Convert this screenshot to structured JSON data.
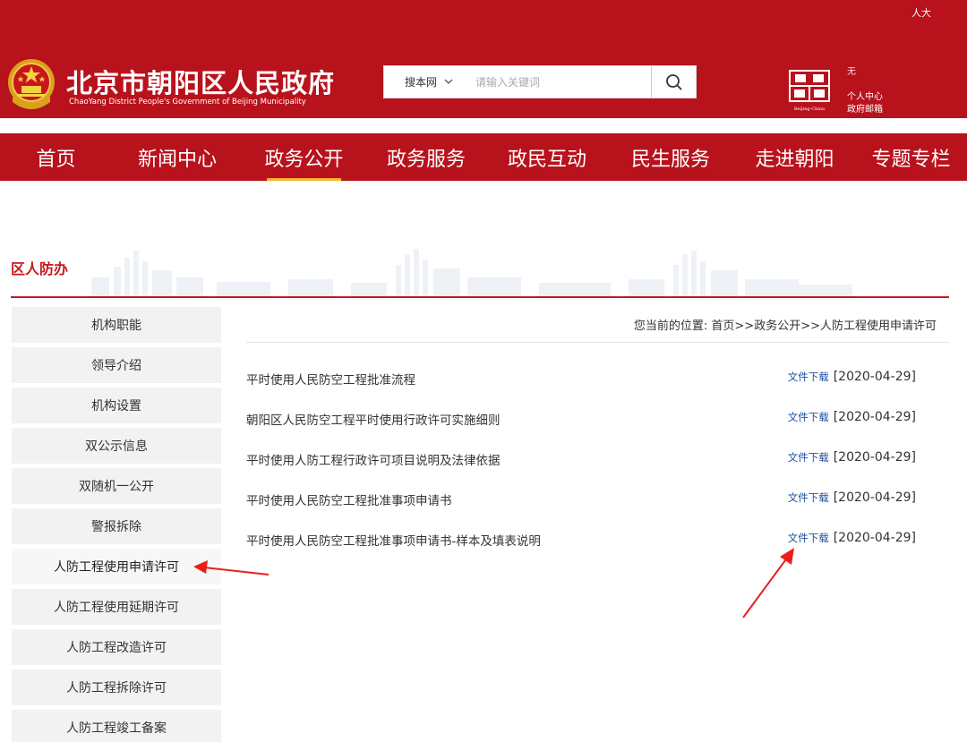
{
  "header": {
    "title": "北京市朝阳区人民政府",
    "subtitle": "ChaoYang District People's Government of Beijing Municipality",
    "top_links": "人大",
    "search": {
      "scope": "搜本网",
      "placeholder": "请输入关键词"
    },
    "logo_text": "Beijing-China",
    "right_links": {
      "item1": "无",
      "personal_center": "个人中心",
      "gov_mail": "政府邮箱"
    }
  },
  "nav": {
    "items": [
      {
        "label": "首页"
      },
      {
        "label": "新闻中心"
      },
      {
        "label": "政务公开"
      },
      {
        "label": "政务服务"
      },
      {
        "label": "政民互动"
      },
      {
        "label": "民生服务"
      },
      {
        "label": "走进朝阳"
      },
      {
        "label": "专题专栏"
      }
    ],
    "active_index": 2
  },
  "section": {
    "title": "区人防办"
  },
  "sidebar": {
    "items": [
      {
        "label": "机构职能"
      },
      {
        "label": "领导介绍"
      },
      {
        "label": "机构设置"
      },
      {
        "label": "双公示信息"
      },
      {
        "label": "双随机一公开"
      },
      {
        "label": "警报拆除"
      },
      {
        "label": "人防工程使用申请许可"
      },
      {
        "label": "人防工程使用延期许可"
      },
      {
        "label": "人防工程改造许可"
      },
      {
        "label": "人防工程拆除许可"
      },
      {
        "label": "人防工程竣工备案"
      }
    ],
    "active_index": 6
  },
  "breadcrumb": "您当前的位置: 首页>>政务公开>>人防工程使用申请许可",
  "documents": [
    {
      "title": "平时使用人民防空工程批准流程",
      "download": "文件下载",
      "date": "[2020-04-29]"
    },
    {
      "title": "朝阳区人民防空工程平时使用行政许可实施细则",
      "download": "文件下载",
      "date": "[2020-04-29]"
    },
    {
      "title": "平时使用人防工程行政许可项目说明及法律依据",
      "download": "文件下载",
      "date": "[2020-04-29]"
    },
    {
      "title": "平时使用人民防空工程批准事项申请书",
      "download": "文件下载",
      "date": "[2020-04-29]"
    },
    {
      "title": "平时使用人民防空工程批准事项申请书-样本及填表说明",
      "download": "文件下载",
      "date": "[2020-04-29]"
    }
  ],
  "colors": {
    "brand_red": "#b8121c",
    "accent_gold": "#f7b633",
    "link_blue": "#1f4fa0",
    "annotation_red": "#e8201a"
  }
}
